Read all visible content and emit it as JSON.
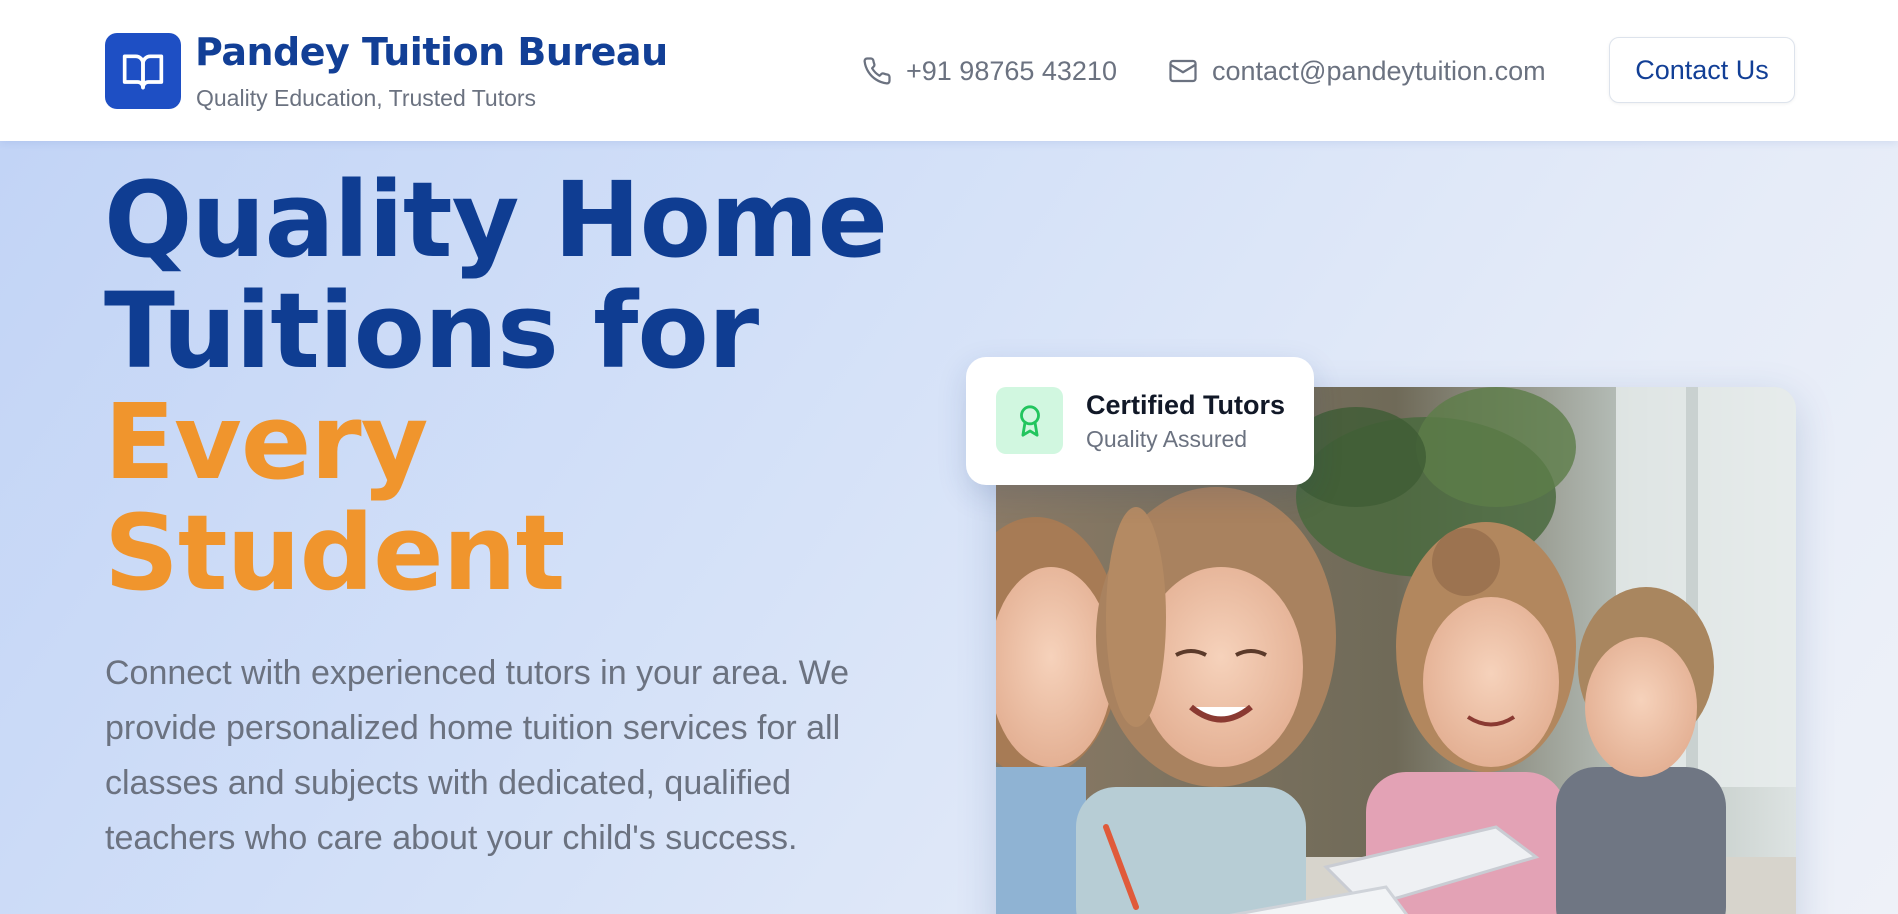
{
  "header": {
    "brand_name": "Pandey Tuition Bureau",
    "tagline": "Quality Education, Trusted Tutors",
    "logo_icon": "open-book-icon",
    "phone": "+91 98765 43210",
    "phone_icon": "phone-icon",
    "email": "contact@pandeytuition.com",
    "email_icon": "mail-icon",
    "cta_label": "Contact Us"
  },
  "hero": {
    "headline_line1": "Quality Home",
    "headline_line2": "Tuitions for",
    "headline_line3": "Every",
    "headline_line4": "Student",
    "description": "Connect with experienced tutors in your area. We provide personalized home tuition services for all classes and subjects with dedicated, qualified teachers who care about your child's success.",
    "badge": {
      "icon": "award-ribbon-icon",
      "title": "Certified Tutors",
      "subtitle": "Quality Assured"
    },
    "image": "children-studying-photo"
  },
  "colors": {
    "brand_blue": "#1e4fc4",
    "heading_blue": "#0f3d92",
    "accent_orange": "#f0952d",
    "text_gray": "#6b7280",
    "badge_green_bg": "#d1f7e0",
    "badge_green_icon": "#22c55e"
  }
}
